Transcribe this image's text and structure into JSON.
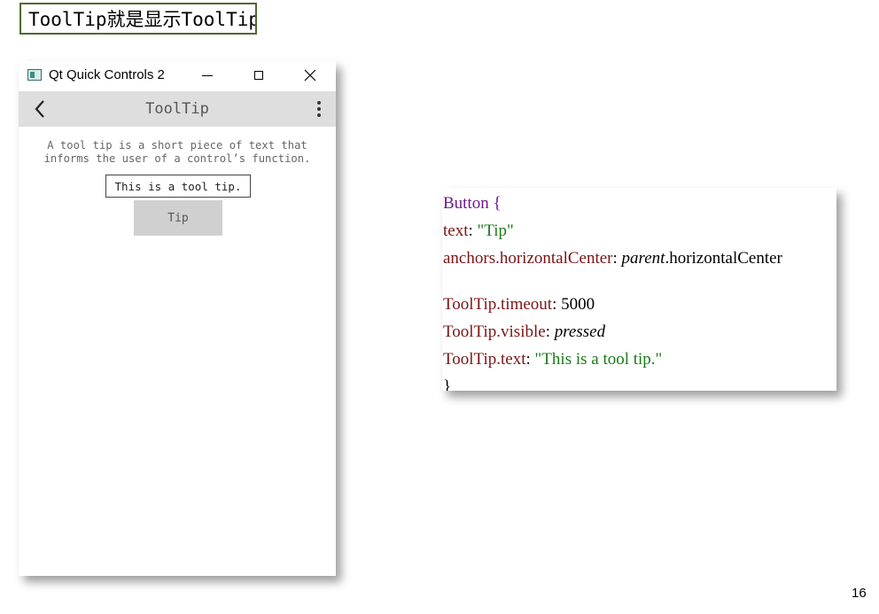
{
  "slide": {
    "title": "ToolTip就是显示ToolTip",
    "page_number": "16"
  },
  "window": {
    "title": "Qt Quick Controls 2",
    "icons": {
      "app": "qt-app-icon",
      "minimize": "minimize-icon",
      "maximize": "maximize-icon",
      "close": "close-icon"
    }
  },
  "toolbar": {
    "title": "ToolTip",
    "back_icon": "chevron-left-icon",
    "menu_icon": "more-vertical-icon"
  },
  "content": {
    "description_line1": "A tool tip is a short piece of text that",
    "description_line2": "informs the user of a control’s function.",
    "tooltip_text": "This is a tool tip.",
    "button_label": "Tip"
  },
  "code": {
    "l1_type": "Button",
    "l1_brace": " {",
    "l2_prop": "text",
    "l2_colon": ": ",
    "l2_value": "\"Tip\"",
    "l3_prop": "anchors.horizontalCenter",
    "l3_colon": ": ",
    "l3_obj": "parent",
    "l3_rest": ".horizontalCenter",
    "l4_prop": "ToolTip.timeout",
    "l4_colon": ": ",
    "l4_value": "5000",
    "l5_prop": "ToolTip.visible",
    "l5_colon": ": ",
    "l5_value": "pressed",
    "l6_prop": "ToolTip.text",
    "l6_colon": ": ",
    "l6_value": "\"This is a tool tip.\"",
    "l7_brace": "}"
  }
}
